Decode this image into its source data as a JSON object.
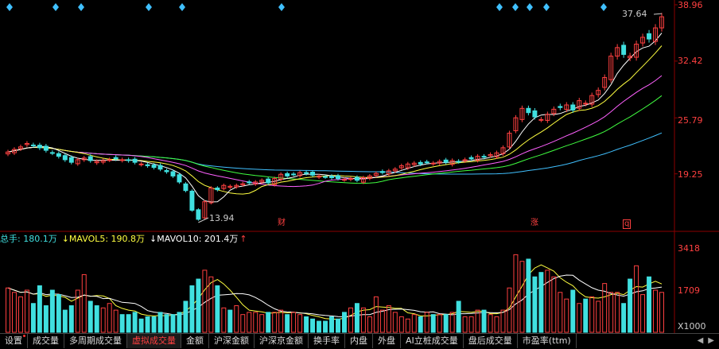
{
  "price_axis": {
    "ticks": [
      "38.96",
      "32.42",
      "25.79",
      "19.25"
    ]
  },
  "volume_axis": {
    "ticks": [
      "3418",
      "1709"
    ],
    "unit": "X1000"
  },
  "price_annotations": {
    "high": "37.64",
    "low": "13.94"
  },
  "event_markers": [
    "财",
    "涨",
    "q"
  ],
  "volume_legend": {
    "total": "总手: 180.1万",
    "mavol5": "↓MAVOL5: 190.8万",
    "mavol10": "↓MAVOL10: 201.4万",
    "trend_arrow": "↑"
  },
  "tabs": [
    {
      "label": "设置",
      "active": false
    },
    {
      "label": "成交量",
      "active": false
    },
    {
      "label": "多周期成交量",
      "active": false
    },
    {
      "label": "虚拟成交量",
      "active": true
    },
    {
      "label": "金额",
      "active": false
    },
    {
      "label": "沪深金额",
      "active": false
    },
    {
      "label": "沪深京金额",
      "active": false
    },
    {
      "label": "换手率",
      "active": false
    },
    {
      "label": "内盘",
      "active": false
    },
    {
      "label": "外盘",
      "active": false
    },
    {
      "label": "AI立桩成交量",
      "active": false
    },
    {
      "label": "盘后成交量",
      "active": false
    },
    {
      "label": "市盈率(ttm)",
      "active": false
    }
  ],
  "tab_nav": {
    "left": "◀",
    "right": "▶"
  },
  "colors": {
    "up": "#ff4040",
    "down": "#40e0e0",
    "ma5": "#ffffff",
    "ma10": "#ffff40",
    "ma20": "#ff60ff",
    "ma30": "#40ff40",
    "ma60": "#40c0ff",
    "marker": "#40c0ff"
  },
  "chart_data": {
    "type": "candlestick",
    "price_range": [
      13.0,
      39.0
    ],
    "volume_range": [
      0,
      3800
    ],
    "closes": [
      21.8,
      22.1,
      22.4,
      22.8,
      22.6,
      22.3,
      22.0,
      21.7,
      21.3,
      20.9,
      20.6,
      20.9,
      21.1,
      20.8,
      20.7,
      20.8,
      20.9,
      21.0,
      20.9,
      20.8,
      20.6,
      20.4,
      20.2,
      20.0,
      19.8,
      19.5,
      19.0,
      18.3,
      17.3,
      15.0,
      13.94,
      16.0,
      17.6,
      17.4,
      17.9,
      17.8,
      17.9,
      18.1,
      18.2,
      18.3,
      18.5,
      18.2,
      18.7,
      19.2,
      19.0,
      19.2,
      19.4,
      19.3,
      19.1,
      19.0,
      18.9,
      18.8,
      18.7,
      18.6,
      18.7,
      18.5,
      18.8,
      19.0,
      19.3,
      19.4,
      19.6,
      19.8,
      20.2,
      20.4,
      20.5,
      20.4,
      20.6,
      20.5,
      20.7,
      20.6,
      20.8,
      20.7,
      20.9,
      21.0,
      21.3,
      21.2,
      21.5,
      21.7,
      22.3,
      24.0,
      25.8,
      26.9,
      26.4,
      25.9,
      25.6,
      26.2,
      26.8,
      27.0,
      27.3,
      26.7,
      27.8,
      27.5,
      28.4,
      29.0,
      30.5,
      33.0,
      34.0,
      33.2,
      33.0,
      34.4,
      35.2,
      35.0,
      36.3,
      37.6
    ],
    "volumes": [
      2000,
      1800,
      1600,
      1900,
      1300,
      2100,
      1200,
      1900,
      1700,
      1000,
      1200,
      1900,
      2600,
      1400,
      1200,
      1100,
      1300,
      1000,
      800,
      800,
      900,
      600,
      700,
      700,
      900,
      800,
      800,
      900,
      1400,
      2100,
      2400,
      2800,
      2500,
      2100,
      1100,
      1000,
      1200,
      800,
      900,
      900,
      800,
      900,
      900,
      1000,
      800,
      900,
      800,
      700,
      600,
      500,
      500,
      700,
      600,
      900,
      1100,
      1300,
      1100,
      700,
      1600,
      1000,
      1200,
      900,
      700,
      600,
      800,
      700,
      900,
      800,
      800,
      800,
      900,
      1400,
      700,
      700,
      1000,
      1000,
      800,
      700,
      1000,
      2000,
      3500,
      3200,
      3300,
      2500,
      2700,
      2800,
      2500,
      1800,
      1500,
      1900,
      1300,
      1500,
      1600,
      1400,
      2200,
      1800,
      1800,
      1300,
      2400,
      3000,
      1700,
      2500,
      1900,
      1800
    ]
  }
}
